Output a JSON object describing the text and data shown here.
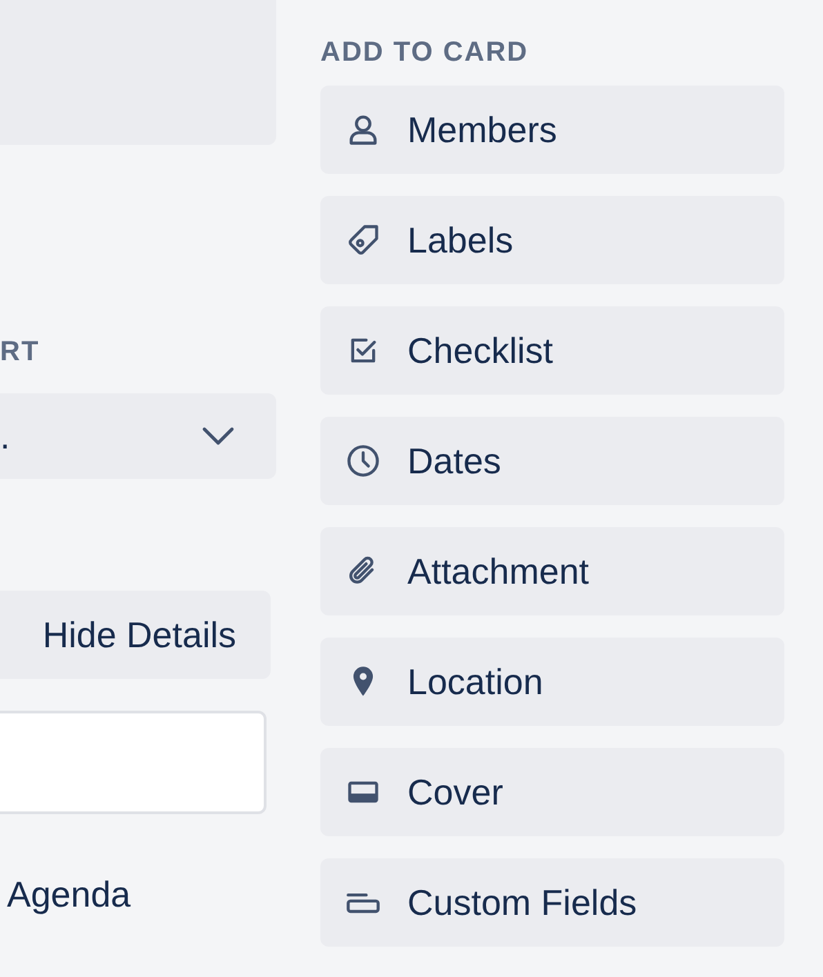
{
  "left_panel": {
    "heading": "RT",
    "select": {
      "value": "."
    },
    "hide_details_button": "Hide Details",
    "text": "Agenda"
  },
  "add_to_card": {
    "heading": "ADD TO CARD",
    "buttons": [
      {
        "label": "Members",
        "kind": "person"
      },
      {
        "label": "Labels",
        "kind": "tag"
      },
      {
        "label": "Checklist",
        "kind": "checkbox"
      },
      {
        "label": "Dates",
        "kind": "clock"
      },
      {
        "label": "Attachment",
        "kind": "paperclip"
      },
      {
        "label": "Location",
        "kind": "pin"
      },
      {
        "label": "Cover",
        "kind": "cover"
      },
      {
        "label": "Custom Fields",
        "kind": "field"
      }
    ]
  }
}
